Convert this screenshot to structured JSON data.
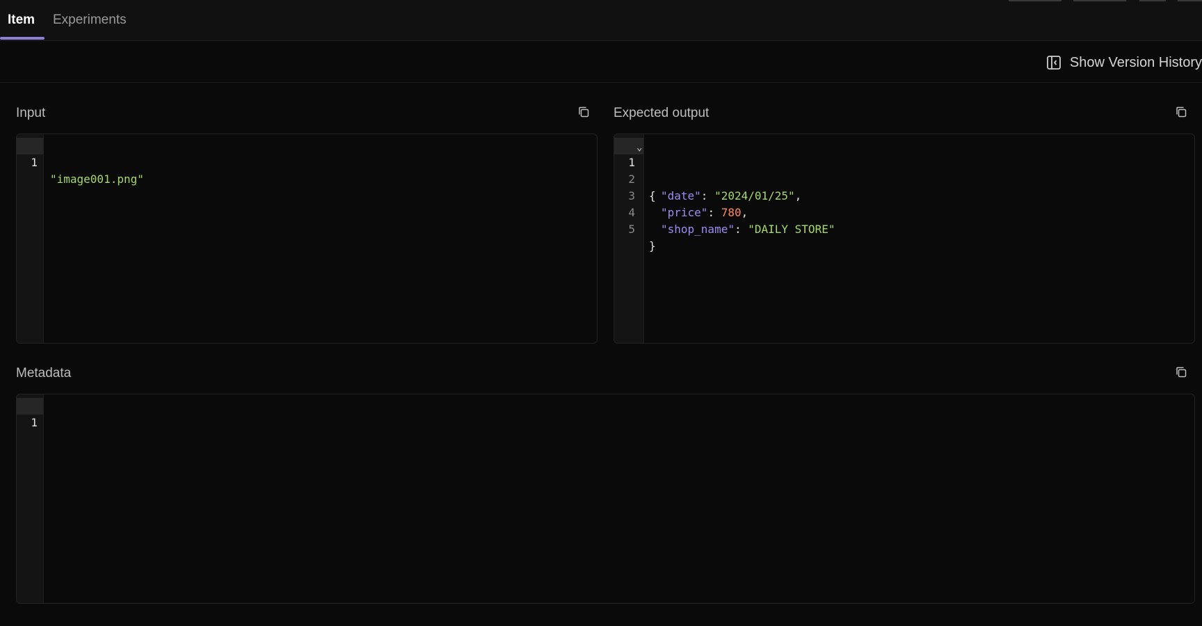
{
  "tabs": [
    {
      "label": "Item",
      "active": true
    },
    {
      "label": "Experiments",
      "active": false
    }
  ],
  "toolbar": {
    "history_label": "Show Version History",
    "history_icon": "sidebar-panel-icon"
  },
  "sections": {
    "input": {
      "title": "Input",
      "copy_icon": "copy-icon",
      "lines": [
        {
          "num": "1",
          "text": "\"image001.png\""
        }
      ]
    },
    "expected": {
      "title": "Expected output",
      "copy_icon": "copy-icon",
      "fold_icon": "chevron-down-icon",
      "lines": [
        {
          "num": "1",
          "open": "{"
        },
        {
          "num": "2",
          "key": "\"date\"",
          "sep": ": ",
          "value": "\"2024/01/25\"",
          "end": ","
        },
        {
          "num": "3",
          "key": "\"price\"",
          "sep": ": ",
          "value": "780",
          "end": ","
        },
        {
          "num": "4",
          "key": "\"shop_name\"",
          "sep": ": ",
          "value": "\"DAILY STORE\"",
          "end": ""
        },
        {
          "num": "5",
          "open": "}"
        }
      ]
    },
    "metadata": {
      "title": "Metadata",
      "copy_icon": "copy-icon",
      "lines": [
        {
          "num": "1",
          "text": ""
        }
      ]
    }
  },
  "colors": {
    "accent": "#8b7fd6",
    "json_key": "#9d8cf2",
    "json_string": "#a6d96a",
    "json_number": "#ff8a5c"
  }
}
